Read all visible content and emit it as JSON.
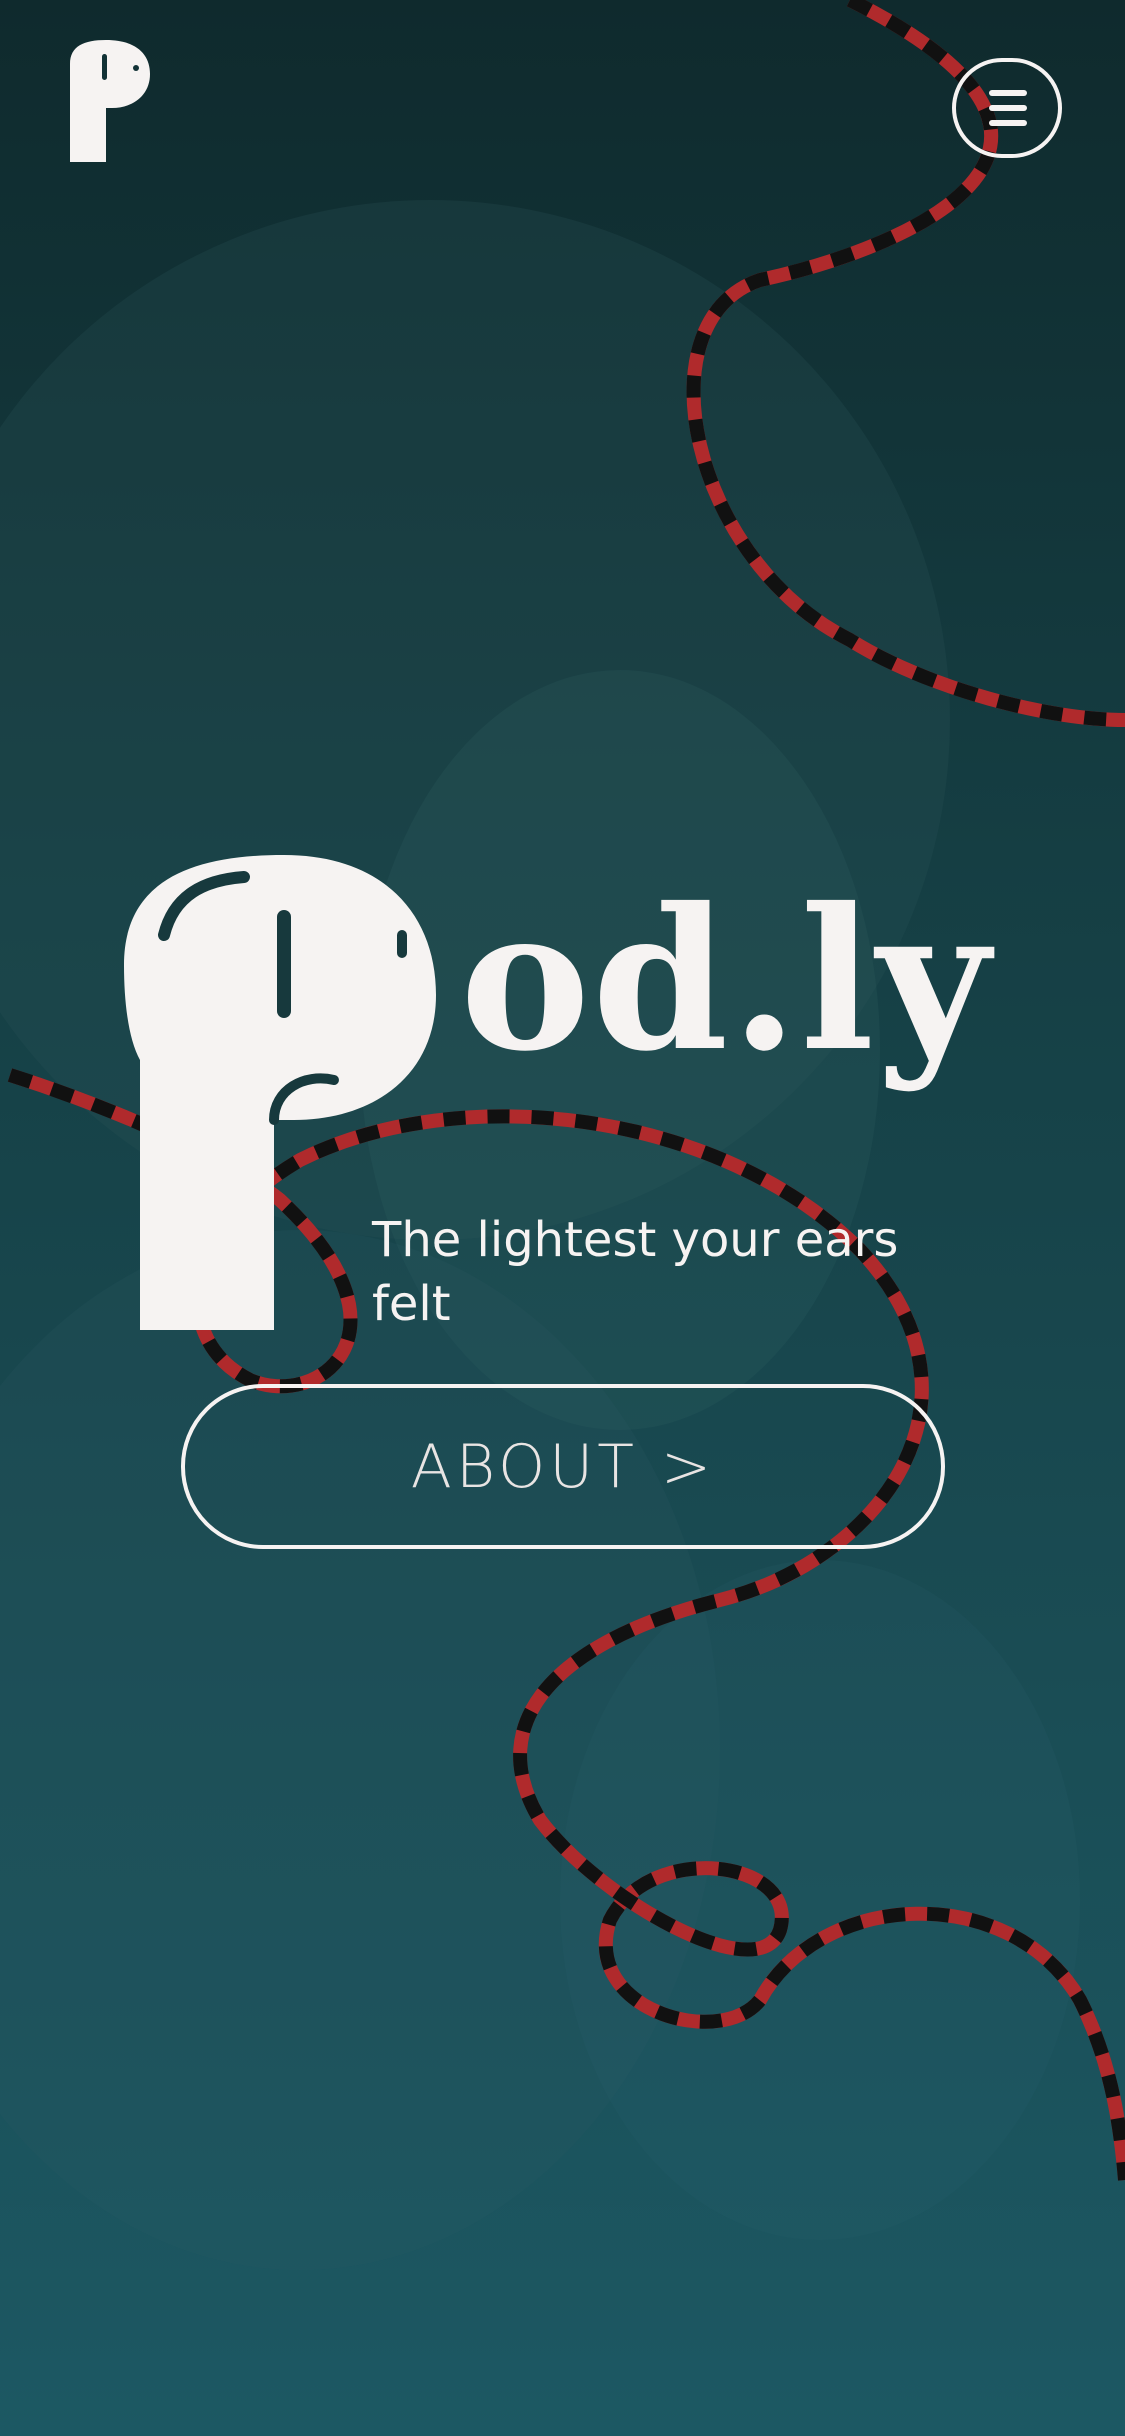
{
  "header": {
    "brand_icon": "earbud-logo-icon",
    "menu_icon": "hamburger-menu-icon"
  },
  "hero": {
    "logo_text": "od.ly",
    "tagline": "The lightest your ears felt",
    "about_label": "ABOUT >"
  },
  "colors": {
    "background_top": "#0f2a2d",
    "background_bottom": "#1c5863",
    "foreground": "#f6f3f2",
    "cable_red": "#b02a2c",
    "cable_dash": "#111111"
  }
}
